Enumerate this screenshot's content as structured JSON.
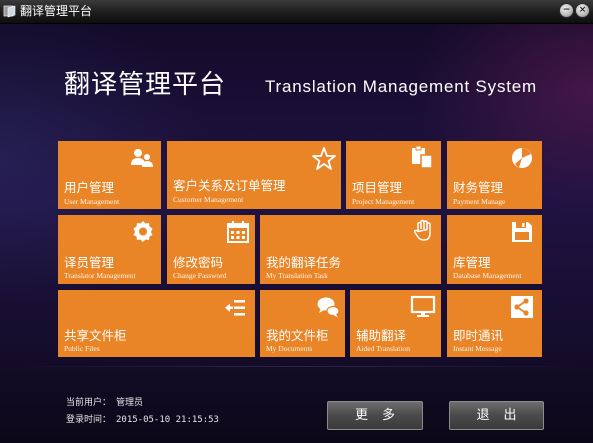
{
  "window": {
    "title": "翻译管理平台",
    "min_symbol": "−",
    "close_symbol": "×"
  },
  "header": {
    "title": "翻译管理平台",
    "subtitle": "Translation Management System"
  },
  "tiles": [
    {
      "label": "用户管理",
      "sub": "User Management",
      "icon": "users-icon"
    },
    {
      "label": "客户关系及订单管理",
      "sub": "Customer Management",
      "icon": "star-icon"
    },
    {
      "label": "项目管理",
      "sub": "Project Management",
      "icon": "clipboard-icon"
    },
    {
      "label": "财务管理",
      "sub": "Payment Manage",
      "icon": "pie-chart-icon"
    },
    {
      "label": "译员管理",
      "sub": "Translator Management",
      "icon": "badge-icon"
    },
    {
      "label": "修改密码",
      "sub": "Change Password",
      "icon": "calendar-icon"
    },
    {
      "label": "我的翻译任务",
      "sub": "My Translation Task",
      "icon": "hand-icon"
    },
    {
      "label": "库管理",
      "sub": "Database Management",
      "icon": "save-icon"
    },
    {
      "label": "共享文件柜",
      "sub": "Public Files",
      "icon": "list-arrow-icon"
    },
    {
      "label": "我的文件柜",
      "sub": "My Documents",
      "icon": "chat-icon"
    },
    {
      "label": "辅助翻译",
      "sub": "Aided Translation",
      "icon": "monitor-icon"
    },
    {
      "label": "即时通讯",
      "sub": "Instant Message",
      "icon": "share-icon"
    }
  ],
  "footer": {
    "current_user_label": "当前用户：",
    "current_user": "管理员",
    "login_time_label": "登录时间：",
    "login_time": "2015-05-10 21:15:53",
    "more_label": "更多",
    "exit_label": "退出"
  },
  "colors": {
    "tile": "#e98427",
    "background": "#1f1242"
  }
}
